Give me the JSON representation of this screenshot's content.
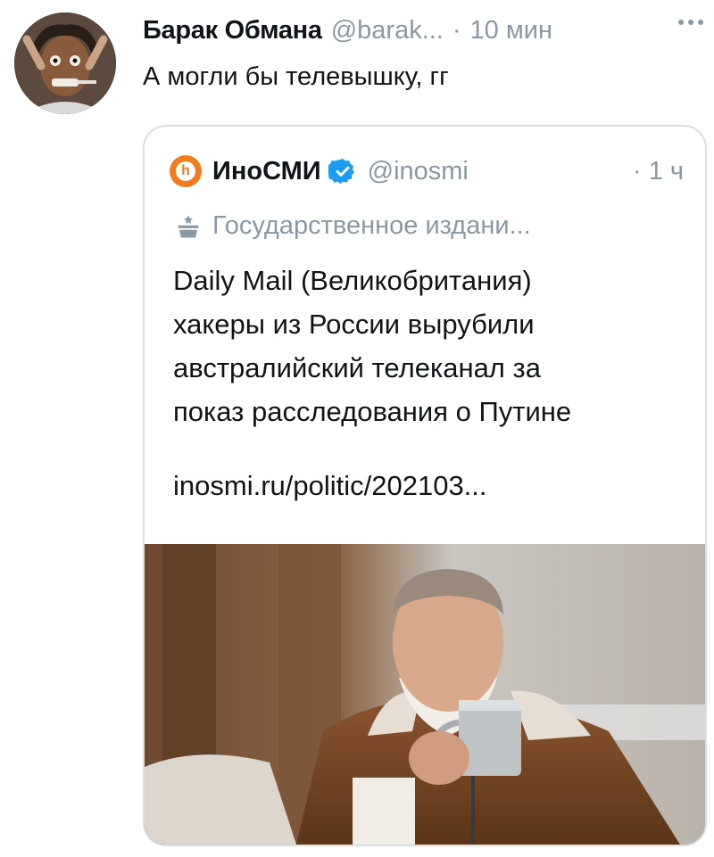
{
  "tweet": {
    "author_name": "Барак Обмана",
    "author_handle": "@barak...",
    "separator": "·",
    "time": "10 мин",
    "text": "А могли бы телевышку, гг",
    "avatar_icon": "user-avatar-photo",
    "more_icon": "more-options-icon"
  },
  "quoted": {
    "name": "ИноСМИ",
    "logo_letter": "h",
    "handle": "@inosmi",
    "separator": "·",
    "time": "1 ч",
    "label": "Государственное издани...",
    "label_icon": "government-building-icon",
    "body_lines": [
      "Daily Mail (Великобритания)",
      "хакеры из России вырубили",
      "австралийский телеканал за",
      "показ расследования о Путине"
    ],
    "link": "inosmi.ru/politic/202103...",
    "photo_icon": "attached-photo",
    "colors": {
      "logo_orange": "#f07b21",
      "verified_blue": "#1d9bf0"
    }
  }
}
